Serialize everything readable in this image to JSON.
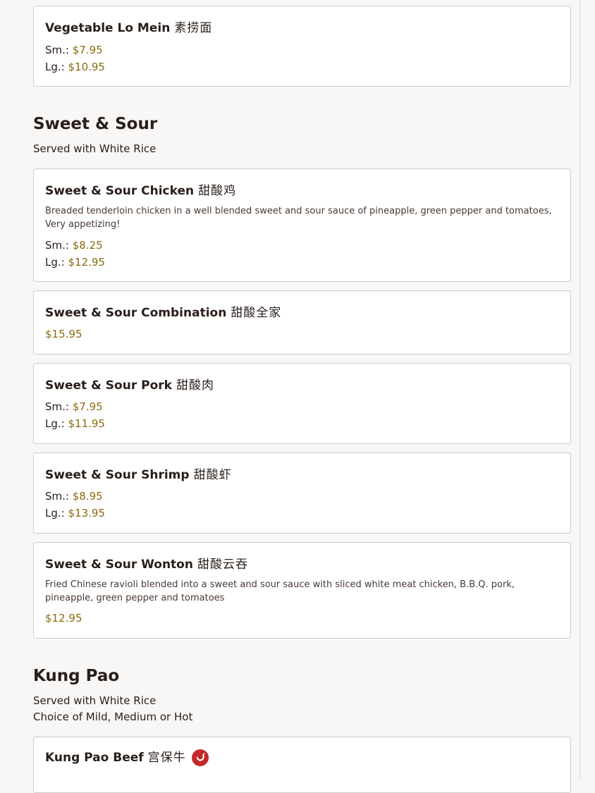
{
  "items": {
    "veg_lo_mein": {
      "name": "Vegetable Lo Mein",
      "chinese": "素捞面",
      "sm_label": "Sm.:",
      "sm_price": "$7.95",
      "lg_label": "Lg.:",
      "lg_price": "$10.95"
    },
    "sweet_chicken": {
      "name": "Sweet & Sour Chicken",
      "chinese": "甜酸鸡",
      "description": "Breaded tenderloin chicken in a well blended sweet and sour sauce of pineapple, green pepper and tomatoes, Very appetizing!",
      "sm_label": "Sm.:",
      "sm_price": "$8.25",
      "lg_label": "Lg.:",
      "lg_price": "$12.95"
    },
    "sweet_combo": {
      "name": "Sweet & Sour Combination",
      "chinese": "甜酸全家",
      "price": "$15.95"
    },
    "sweet_pork": {
      "name": "Sweet & Sour Pork",
      "chinese": "甜酸肉",
      "sm_label": "Sm.:",
      "sm_price": "$7.95",
      "lg_label": "Lg.:",
      "lg_price": "$11.95"
    },
    "sweet_shrimp": {
      "name": "Sweet & Sour Shrimp",
      "chinese": "甜酸虾",
      "sm_label": "Sm.:",
      "sm_price": "$8.95",
      "lg_label": "Lg.:",
      "lg_price": "$13.95"
    },
    "sweet_wonton": {
      "name": "Sweet & Sour Wonton",
      "chinese": "甜酸云吞",
      "description": "Fried Chinese ravioli blended into a sweet and sour sauce with sliced white meat chicken, B.B.Q. pork, pineapple, green pepper and tomatoes",
      "price": "$12.95"
    },
    "kung_pao_beef": {
      "name": "Kung Pao Beef",
      "chinese": "宫保牛",
      "spicy_icon": "chili-pepper-icon"
    }
  },
  "sections": {
    "sweet_sour": {
      "title": "Sweet & Sour",
      "note": "Served with White Rice"
    },
    "kung_pao": {
      "title": "Kung Pao",
      "note1": "Served with White Rice",
      "note2": "Choice of Mild, Medium or Hot"
    }
  },
  "colors": {
    "price": "#8b6a10",
    "spicy_badge": "#c4282c",
    "card_border": "#d0cdca",
    "background": "#f8f7f5"
  }
}
